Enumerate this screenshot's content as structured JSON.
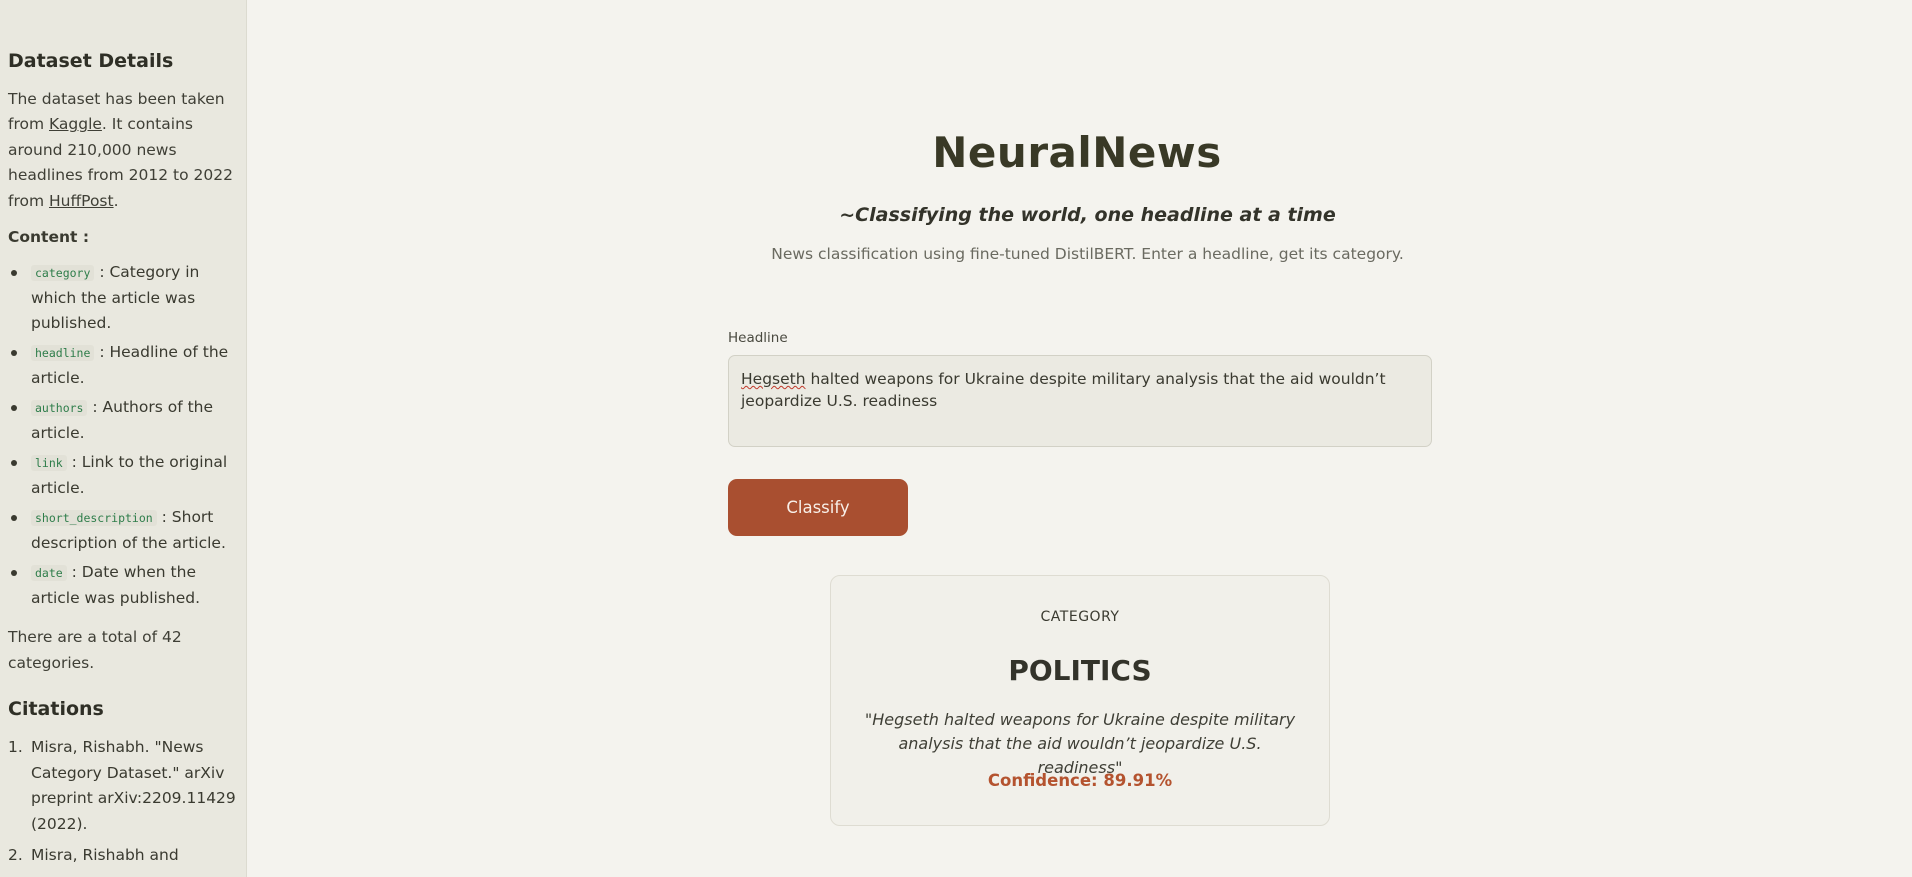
{
  "sidebar": {
    "dataset_heading": "Dataset Details",
    "intro_1": "The dataset has been taken from ",
    "kaggle_link": "Kaggle",
    "intro_2": ". It contains around 210,000 news headlines from 2012 to 2022 from ",
    "huffpost_link": "HuffPost",
    "intro_3": ".",
    "content_label": "Content :",
    "fields": [
      {
        "name": "category",
        "desc": " : Category in which the article was published."
      },
      {
        "name": "headline",
        "desc": " : Headline of the article."
      },
      {
        "name": "authors",
        "desc": " : Authors of the article."
      },
      {
        "name": "link",
        "desc": " : Link to the original article."
      },
      {
        "name": "short_description",
        "desc": " : Short description of the article."
      },
      {
        "name": "date",
        "desc": " : Date when the article was published."
      }
    ],
    "total_categories": "There are a total of 42 categories.",
    "citations_heading": "Citations",
    "citations": [
      "Misra, Rishabh. \"News Category Dataset.\" arXiv preprint arXiv:2209.11429 (2022).",
      "Misra, Rishabh and"
    ]
  },
  "main": {
    "title": "NeuralNews",
    "tagline": "~Classifying the world, one headline at a time",
    "subtitle": "News classification using fine-tuned DistilBERT. Enter a headline, get its category.",
    "headline_label": "Headline",
    "headline_value_misspelled": "Hegseth",
    "headline_value_rest": " halted weapons for Ukraine despite military analysis that the aid wouldn’t jeopardize U.S. readiness",
    "classify_label": "Classify"
  },
  "result": {
    "kicker": "CATEGORY",
    "category": "POLITICS",
    "quote": "\"Hegseth halted weapons for Ukraine despite military analysis that the aid wouldn’t jeopardize U.S. readiness\"",
    "confidence": "Confidence: 89.91%"
  },
  "colors": {
    "accent": "#a94f30",
    "confidence": "#b4532f",
    "field_code": "#2e7d4a"
  }
}
